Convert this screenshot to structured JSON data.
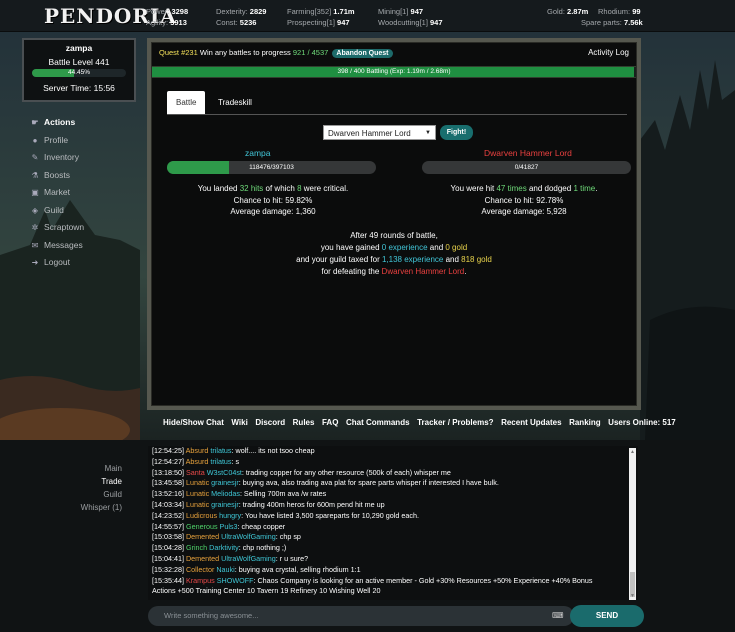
{
  "logo": "PENDORIA",
  "stats": {
    "power": {
      "label": "Power:",
      "value": "3298"
    },
    "agility": {
      "label": "Agility:",
      "value": "3913"
    },
    "dexterity": {
      "label": "Dexterity:",
      "value": "2829"
    },
    "const": {
      "label": "Const:",
      "value": "5236"
    },
    "farming": {
      "label": "Farming",
      "level": "[352]",
      "value": "1.71m"
    },
    "prospecting": {
      "label": "Prospecting",
      "level": "[1]",
      "value": "947"
    },
    "mining": {
      "label": "Mining",
      "level": "[1]",
      "value": "947"
    },
    "woodcutting": {
      "label": "Woodcutting",
      "level": "[1]",
      "value": "947"
    },
    "gold": {
      "label": "Gold:",
      "value": "2.87m"
    },
    "rhodium": {
      "label": "Rhodium:",
      "value": "99"
    },
    "spare_parts": {
      "label": "Spare parts:",
      "value": "7.56k"
    }
  },
  "player_panel": {
    "name": "zampa",
    "battle_level": "Battle Level 441",
    "progress_text": "44.45%",
    "progress": 0.4445,
    "server_time": "Server Time: 15:56"
  },
  "nav": [
    {
      "label": "Actions",
      "icon": "hand-icon",
      "glyph": "☛"
    },
    {
      "label": "Profile",
      "icon": "user-icon",
      "glyph": "●"
    },
    {
      "label": "Inventory",
      "icon": "wrench-icon",
      "glyph": "✎"
    },
    {
      "label": "Boosts",
      "icon": "flask-icon",
      "glyph": "⚗"
    },
    {
      "label": "Market",
      "icon": "cart-icon",
      "glyph": "▣"
    },
    {
      "label": "Guild",
      "icon": "shield-icon",
      "glyph": "◈"
    },
    {
      "label": "Scraptown",
      "icon": "gear-icon",
      "glyph": "✲"
    },
    {
      "label": "Messages",
      "icon": "chat-icon",
      "glyph": "✉"
    },
    {
      "label": "Logout",
      "icon": "logout-icon",
      "glyph": "➜"
    }
  ],
  "quest": {
    "id_text": "Quest #231",
    "desc": "Win any battles to progress",
    "progress_text": "921 / 4537",
    "abandon_label": "Abandon Quest",
    "activity_log_label": "Activity Log"
  },
  "battle_bar": {
    "text": "398 / 400 Battling (Exp: 1.19m / 2.68m)",
    "progress": 0.995
  },
  "tabs": [
    "Battle",
    "Tradeskill"
  ],
  "select": {
    "value": "Dwarven Hammer Lord",
    "fight_label": "Fight!"
  },
  "player": {
    "name": "zampa",
    "hp_text": "118476/397103",
    "hp": 0.2984,
    "stats_1a": "You landed ",
    "hits": "32 hits",
    "stats_1b": " of which ",
    "crits": "8",
    "stats_1c": " were critical.",
    "chance": "Chance to hit: 59.82%",
    "avg": "Average damage: 1,360"
  },
  "enemy": {
    "name": "Dwarven Hammer Lord",
    "hp_text": "0/41827",
    "hp": 0,
    "stats_1a": "You were hit ",
    "times": "47 times",
    "stats_1b": " and dodged ",
    "dodged": "1 time",
    "stats_1c": ".",
    "chance": "Chance to hit: 92.78%",
    "avg": "Average damage: 5,928"
  },
  "summary": {
    "rounds": "After 49 rounds of battle,",
    "gained_a": "you have gained ",
    "exp": "0 experience",
    "gained_b": " and ",
    "gold": "0 gold",
    "taxed_a": "and your guild taxed for ",
    "taxed_exp": "1,138 experience",
    "taxed_b": " and ",
    "taxed_gold": "818 gold",
    "defeat_a": "for defeating the ",
    "defeat_enemy": "Dwarven Hammer Lord",
    "defeat_b": "."
  },
  "links": [
    "Hide/Show Chat",
    "Wiki",
    "Discord",
    "Rules",
    "FAQ",
    "Chat Commands",
    "Tracker / Problems?",
    "Recent Updates",
    "Ranking",
    "Users Online: 517"
  ],
  "chat_tabs": [
    "Main",
    "Trade",
    "Guild",
    "Whisper (1)"
  ],
  "chat": [
    {
      "time": "[12:54:25]",
      "tag": "Absurd",
      "tag_color": "#e8a23c",
      "name": "trilatus",
      "name_color": "#3fc7d6",
      "msg": ": wolf.... its not tsoo cheap"
    },
    {
      "time": "[12:54:27]",
      "tag": "Absurd",
      "tag_color": "#e8a23c",
      "name": "trilatus",
      "name_color": "#3fc7d6",
      "msg": ": s"
    },
    {
      "time": "[13:18:50]",
      "tag": "Santa",
      "tag_color": "#e84a4a",
      "name": "W3stC04st",
      "name_color": "#3fc7d6",
      "msg": ": trading copper for any other resource (500k of each) whisper me"
    },
    {
      "time": "[13:45:58]",
      "tag": "Lunatic",
      "tag_color": "#e8a23c",
      "name": "grainesjr",
      "name_color": "#3fc7d6",
      "msg": ": buying ava, also trading ava plat for spare parts whisper if interested I have bulk."
    },
    {
      "time": "[13:52:16]",
      "tag": "Lunatic",
      "tag_color": "#e8a23c",
      "name": "Meliodas",
      "name_color": "#3fc7d6",
      "msg": ": Selling 700m ava /w rates"
    },
    {
      "time": "[14:03:34]",
      "tag": "Lunatic",
      "tag_color": "#e8a23c",
      "name": "grainesjr",
      "name_color": "#3fc7d6",
      "msg": ": trading 400m heros for 600m pend hit me up"
    },
    {
      "time": "[14:23:52]",
      "tag": "Ludicrous",
      "tag_color": "#e8a23c",
      "name": "hungry",
      "name_color": "#3fc7d6",
      "msg": ": You have listed 3,500 spareparts for 10,290 gold each."
    },
    {
      "time": "[14:55:57]",
      "tag": "Generous",
      "tag_color": "#4fd36a",
      "name": "Puls3",
      "name_color": "#3fc7d6",
      "msg": ": cheap copper"
    },
    {
      "time": "[15:03:58]",
      "tag": "Demented",
      "tag_color": "#e8a23c",
      "name": "UltraWolfGaming",
      "name_color": "#3fc7d6",
      "msg": ": chp sp"
    },
    {
      "time": "[15:04:28]",
      "tag": "Grinch",
      "tag_color": "#4fd36a",
      "name": "Darktivity",
      "name_color": "#3fc7d6",
      "msg": ": chp nothing ;)"
    },
    {
      "time": "[15:04:41]",
      "tag": "Demented",
      "tag_color": "#e8a23c",
      "name": "UltraWolfGaming",
      "name_color": "#3fc7d6",
      "msg": ": r u sure?"
    },
    {
      "time": "[15:32:28]",
      "tag": "Collector",
      "tag_color": "#e8a23c",
      "name": "Nauki",
      "name_color": "#3fc7d6",
      "msg": ": buying ava crystal, selling rhodium 1:1"
    },
    {
      "time": "[15:35:44]",
      "tag": "Krampus",
      "tag_color": "#e84a4a",
      "name": "SHOWOFF",
      "name_color": "#3fc7d6",
      "msg": ": Chaos Company is looking for an active member - Gold +30% Resources +50% Experience +40% Bonus"
    },
    {
      "time": "",
      "tag": "",
      "tag_color": "#fff",
      "name": "",
      "name_color": "#fff",
      "msg": "Actions +500 Training Center 10 Tavern 19 Refinery 10 Wishing Well 20"
    }
  ],
  "chat_input": {
    "placeholder": "Write something awesome...",
    "send_label": "SEND"
  },
  "colors": {
    "accent": "#1a6b6c",
    "progress_green": "#2e9a4a",
    "enemy_red": "#e8403f"
  }
}
